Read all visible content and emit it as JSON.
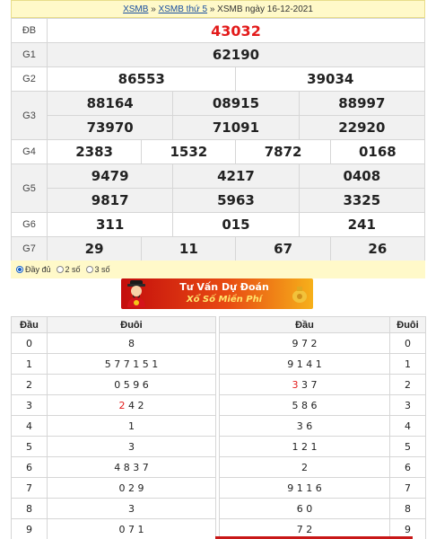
{
  "breadcrumb": {
    "link1": "XSMB",
    "sep1": " » ",
    "link2": "XSMB thứ 5",
    "sep2": " » ",
    "current": "XSMB ngày 16-12-2021"
  },
  "results": {
    "db": {
      "label": "ĐB",
      "values": [
        "43032"
      ]
    },
    "g1": {
      "label": "G1",
      "values": [
        "62190"
      ]
    },
    "g2": {
      "label": "G2",
      "values": [
        "86553",
        "39034"
      ]
    },
    "g3": {
      "label": "G3",
      "row1": [
        "88164",
        "08915",
        "88997"
      ],
      "row2": [
        "73970",
        "71091",
        "22920"
      ]
    },
    "g4": {
      "label": "G4",
      "values": [
        "2383",
        "1532",
        "7872",
        "0168"
      ]
    },
    "g5": {
      "label": "G5",
      "row1": [
        "9479",
        "4217",
        "0408"
      ],
      "row2": [
        "9817",
        "5963",
        "3325"
      ]
    },
    "g6": {
      "label": "G6",
      "values": [
        "311",
        "015",
        "241"
      ]
    },
    "g7": {
      "label": "G7",
      "values": [
        "29",
        "11",
        "67",
        "26"
      ]
    }
  },
  "display_options": {
    "options": [
      "Đầy đủ",
      "2 số",
      "3 số"
    ],
    "selected": "Đầy đủ"
  },
  "banner": {
    "line1": "Tư Vấn Dự Đoán",
    "line2": "Xổ Số Miền Phí"
  },
  "loto": {
    "headers": {
      "dau": "Đầu",
      "duoi": "Đuôi"
    },
    "left": [
      {
        "dau": "0",
        "duoi": "8"
      },
      {
        "dau": "1",
        "duoi": "5 7 7 1 5 1"
      },
      {
        "dau": "2",
        "duoi": "0 5 9 6"
      },
      {
        "dau": "3",
        "duoi_red": "2",
        "duoi_rest": " 4 2"
      },
      {
        "dau": "4",
        "duoi": "1"
      },
      {
        "dau": "5",
        "duoi": "3"
      },
      {
        "dau": "6",
        "duoi": "4 8 3 7"
      },
      {
        "dau": "7",
        "duoi": "0 2 9"
      },
      {
        "dau": "8",
        "duoi": "3"
      },
      {
        "dau": "9",
        "duoi": "0 7 1"
      }
    ],
    "right": [
      {
        "dau": "9 7 2",
        "duoi": "0"
      },
      {
        "dau": "9 1 4 1",
        "duoi": "1"
      },
      {
        "dau_red": "3",
        "dau_rest": " 3 7",
        "duoi": "2"
      },
      {
        "dau": "5 8 6",
        "duoi": "3"
      },
      {
        "dau": "3 6",
        "duoi": "4"
      },
      {
        "dau": "1 2 1",
        "duoi": "5"
      },
      {
        "dau": "2",
        "duoi": "6"
      },
      {
        "dau": "9 1 1 6",
        "duoi": "7"
      },
      {
        "dau": "6 0",
        "duoi": "8"
      },
      {
        "dau": "7 2",
        "duoi": "9"
      }
    ]
  },
  "colors": {
    "special_prize": "#e31b1b",
    "header_bg": "#fff9c9",
    "link": "#1a4fa0"
  },
  "icons": {
    "banner_character": "god-of-wealth-icon",
    "banner_coin": "coin-bag-icon"
  }
}
